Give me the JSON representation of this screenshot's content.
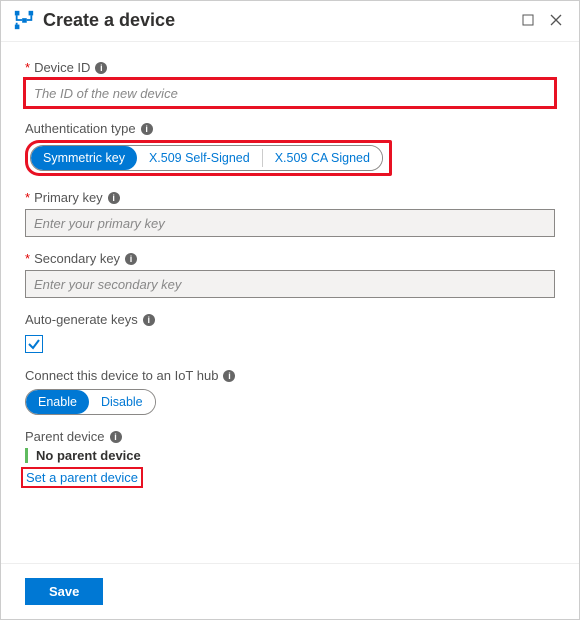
{
  "header": {
    "title": "Create a device"
  },
  "device_id": {
    "label": "Device ID",
    "placeholder": "The ID of the new device",
    "required": true
  },
  "auth_type": {
    "label": "Authentication type",
    "options": [
      "Symmetric key",
      "X.509 Self-Signed",
      "X.509 CA Signed"
    ],
    "selected": 0
  },
  "primary_key": {
    "label": "Primary key",
    "placeholder": "Enter your primary key",
    "required": true
  },
  "secondary_key": {
    "label": "Secondary key",
    "placeholder": "Enter your secondary key",
    "required": true
  },
  "auto_generate": {
    "label": "Auto-generate keys",
    "checked": true
  },
  "connect_hub": {
    "label": "Connect this device to an IoT hub",
    "options": [
      "Enable",
      "Disable"
    ],
    "selected": 0
  },
  "parent_device": {
    "label": "Parent device",
    "value": "No parent device",
    "link": "Set a parent device"
  },
  "footer": {
    "save": "Save"
  }
}
